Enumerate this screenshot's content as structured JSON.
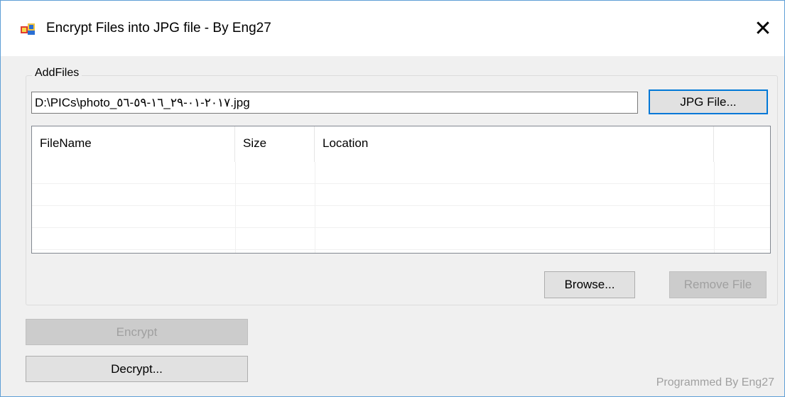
{
  "window": {
    "title": "Encrypt Files into JPG file - By Eng27",
    "close_symbol": "✕"
  },
  "addfiles": {
    "group_label": "AddFiles",
    "path_value": "D:\\PICs\\photo_٢٠١٧-٠١-٢٩_١٦-٥٩-٥٦.jpg",
    "jpg_button": "JPG File...",
    "browse_button": "Browse...",
    "remove_button": "Remove File"
  },
  "filelist": {
    "columns": [
      "FileName",
      "Size",
      "Location"
    ]
  },
  "actions": {
    "encrypt_button": "Encrypt",
    "decrypt_button": "Decrypt..."
  },
  "footer": {
    "credit": "Programmed By Eng27"
  },
  "colors": {
    "focus_border": "#0078d7",
    "window_border": "#5f9fd6"
  }
}
